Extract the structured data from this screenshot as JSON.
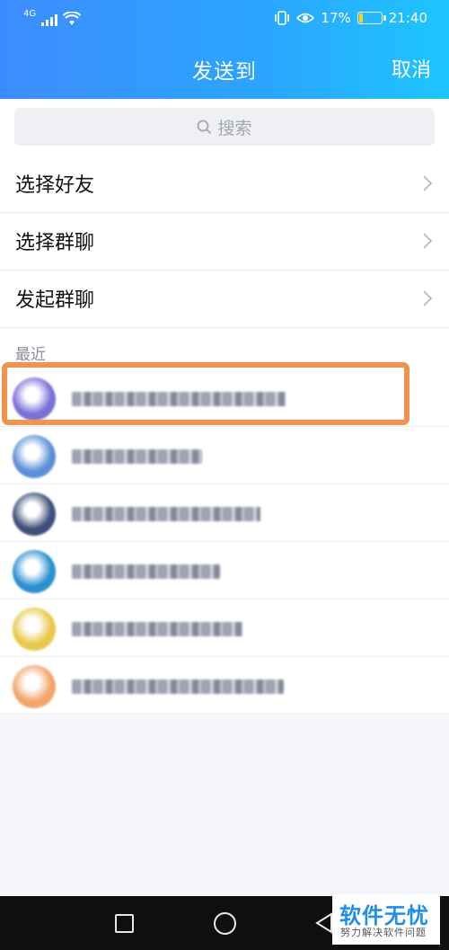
{
  "status_bar": {
    "network_label": "4G",
    "battery_percent": "17%",
    "battery_level": 0.17,
    "time": "21:40",
    "icons": [
      "signal-icon",
      "wifi-icon",
      "vibrate-icon",
      "eye-protection-icon",
      "battery-icon"
    ]
  },
  "header": {
    "title": "发送到",
    "cancel_label": "取消"
  },
  "search": {
    "placeholder": "搜索",
    "icon": "search-icon"
  },
  "menu": [
    {
      "label": "选择好友",
      "icon": "chevron-right-icon"
    },
    {
      "label": "选择群聊",
      "icon": "chevron-right-icon"
    },
    {
      "label": "发起群聊",
      "icon": "chevron-right-icon"
    }
  ],
  "recent": {
    "section_label": "最近",
    "highlight_color": "#f3924a",
    "contacts": [
      {
        "avatar_color": "#7b6fd8",
        "highlighted": true
      },
      {
        "avatar_color": "#5a8fd8",
        "highlighted": false
      },
      {
        "avatar_color": "#3f4f7a",
        "highlighted": false
      },
      {
        "avatar_color": "#2b8fd0",
        "highlighted": false
      },
      {
        "avatar_color": "#e8c84a",
        "highlighted": false
      },
      {
        "avatar_color": "#f2a56b",
        "highlighted": false
      }
    ]
  },
  "system_nav": {
    "icons": [
      "recent-apps-icon",
      "home-icon",
      "back-icon"
    ]
  },
  "watermark": {
    "title": "软件无忧",
    "subtitle": "努力解决软件问题"
  },
  "colors": {
    "header_gradient_start": "#3d8cff",
    "header_gradient_end": "#1ec5ff",
    "watermark_blue": "#1f8eea"
  }
}
